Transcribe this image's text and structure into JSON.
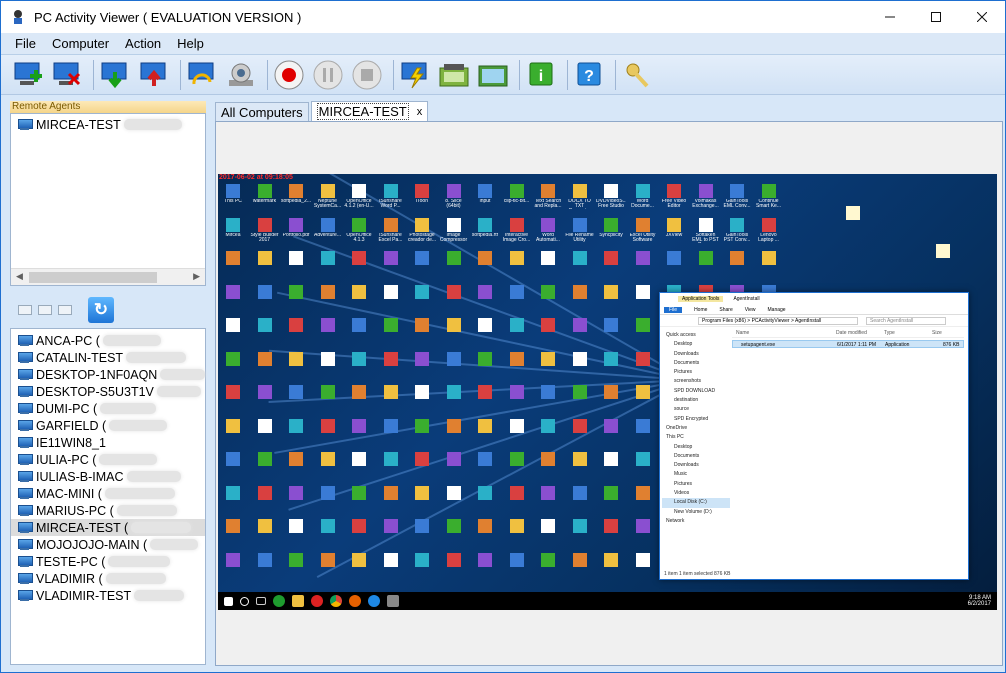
{
  "window": {
    "title": "PC Activity Viewer ( EVALUATION VERSION )"
  },
  "menu": [
    "File",
    "Computer",
    "Action",
    "Help"
  ],
  "remote_agents": {
    "header": "Remote Agents",
    "items": [
      "MIRCEA-TEST"
    ]
  },
  "computers": [
    {
      "name": "ANCA-PC ("
    },
    {
      "name": "CATALIN-TEST"
    },
    {
      "name": "DESKTOP-1NF0AQN"
    },
    {
      "name": "DESKTOP-S5U3T1V"
    },
    {
      "name": "DUMI-PC ("
    },
    {
      "name": "GARFIELD ("
    },
    {
      "name": "IE11WIN8_1"
    },
    {
      "name": "IULIA-PC ("
    },
    {
      "name": "IULIAS-B-IMAC"
    },
    {
      "name": "MAC-MINI ("
    },
    {
      "name": "MARIUS-PC ("
    },
    {
      "name": "MIRCEA-TEST ("
    },
    {
      "name": "MOJOJOJO-MAIN ("
    },
    {
      "name": "TESTE-PC ("
    },
    {
      "name": "VLADIMIR ("
    },
    {
      "name": "VLADIMIR-TEST"
    }
  ],
  "selected_computer": "MIRCEA-TEST (",
  "tabs": [
    {
      "label": "All Computers"
    },
    {
      "label": "MIRCEA-TEST",
      "close": "x"
    }
  ],
  "screenshot": {
    "timestamp": "2017-06-02 at 09:18:05",
    "desktop_icons": [
      "This PC",
      "watermark",
      "softpedia_2...",
      "Neptune SystemCa...",
      "OpenOffice 4.1.2 (en-U...",
      "iSunshare Word P...",
      "iToon",
      "8. Slice (64bit)",
      "input",
      "clip-tic-bit...",
      "Text Search and Repla...",
      "DOCX TO TXT Converter",
      "DVDVideoS... Free Studio",
      "Word Docume...",
      "Free Video Editor",
      "Voimakas Exchange...",
      "GainTools EML Conv...",
      "Continue Smart Ke...",
      "Mircea",
      "Style Builder 2017",
      "Portfolio.pdf",
      "Adventure...",
      "OpenOffice 4.1.3",
      "iSunshare Excel Pa...",
      "Photostage creador de...",
      "Image Compressor",
      "softpedia.rtf",
      "Interactive Image Cro...",
      "Word Automati...",
      "File Rename Utility",
      "Syncplicity",
      "Excel Utility Software",
      "JXView",
      "Softaken EML to PST Conv...",
      "GainTools PST Conv...",
      "Lenovo Laptop ..."
    ],
    "taskbar_clock": [
      "9:18 AM",
      "6/2/2017"
    ]
  },
  "explorer": {
    "title": "AgentInstall",
    "ribbon": [
      "File",
      "Home",
      "Share",
      "View",
      "Manage"
    ],
    "context_tab": "Application Tools",
    "path": "Program Files (x86) > PCActivityViewer > AgentInstall",
    "search": "Search AgentInstall",
    "nav": [
      "Quick access",
      "Desktop",
      "Downloads",
      "Documents",
      "Pictures",
      "screenshots",
      "SPD DOWNLOAD",
      "destination",
      "source",
      "SPD Encrypted",
      "OneDrive",
      "This PC",
      "Desktop",
      "Documents",
      "Downloads",
      "Music",
      "Pictures",
      "Videos",
      "Local Disk (C:)",
      "New Volume (D:)",
      "Network"
    ],
    "columns": [
      "Name",
      "Date modified",
      "Type",
      "Size"
    ],
    "file": {
      "name": "setupagent.exe",
      "date": "6/1/2017 1:11 PM",
      "type": "Application",
      "size": "876 KB"
    },
    "status": "1 item    1 item selected  876 KB"
  },
  "colors": {
    "accent": "#1e6fd0",
    "record": "#e00000",
    "panel": "#d7e7f8"
  }
}
